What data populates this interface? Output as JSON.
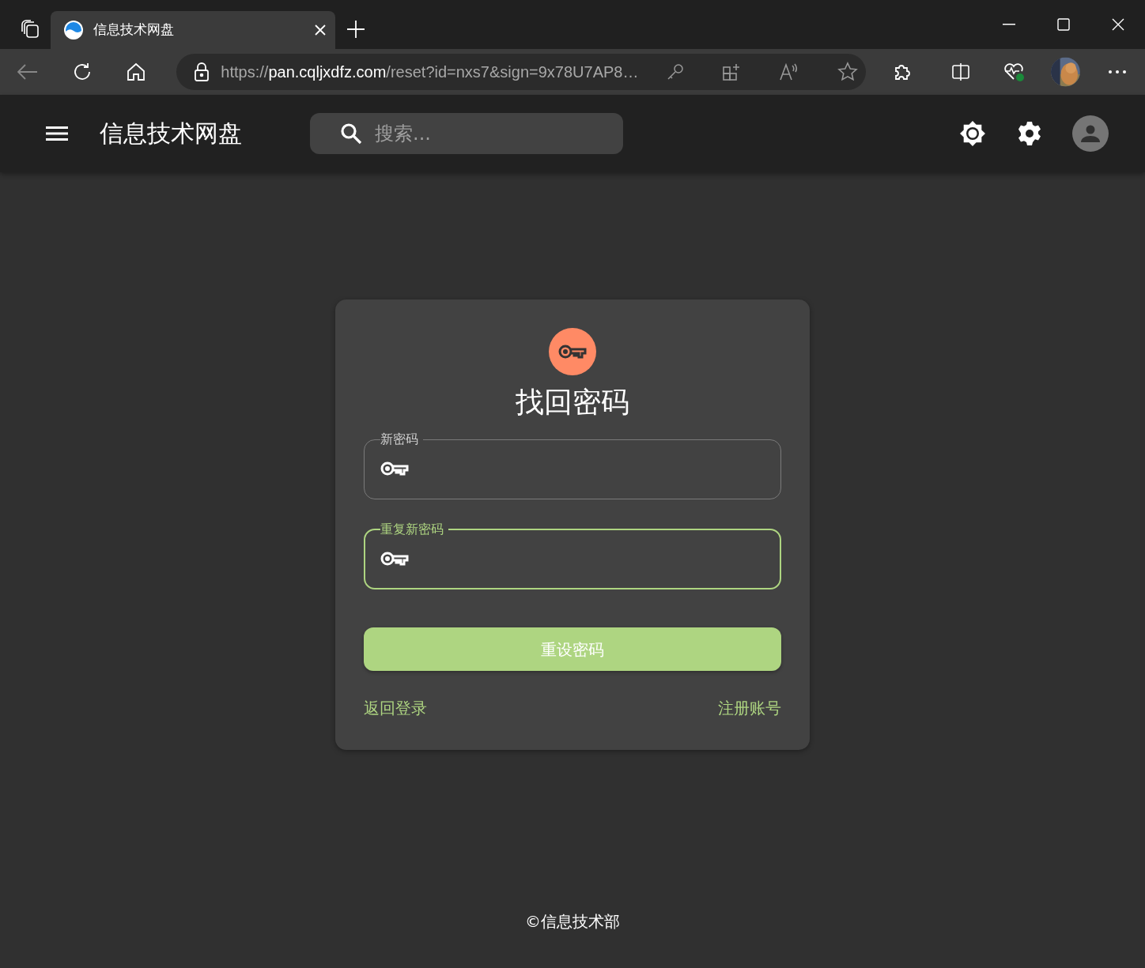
{
  "browser": {
    "tab": {
      "title": "信息技术网盘",
      "selected": true
    },
    "address": {
      "scheme": "https://",
      "host": "pan.cqljxdfz.com",
      "path": "/reset?id=nxs7&sign=9x78U7AP8…"
    }
  },
  "app_bar": {
    "title": "信息技术网盘",
    "search": {
      "placeholder": "搜索..."
    }
  },
  "card": {
    "title": "找回密码",
    "fields": [
      {
        "label": "新密码",
        "focused": false
      },
      {
        "label": "重复新密码",
        "focused": true
      }
    ],
    "submit": "重设密码",
    "links": [
      "返回登录",
      "注册账号"
    ]
  },
  "footer": "©信息技术部"
}
